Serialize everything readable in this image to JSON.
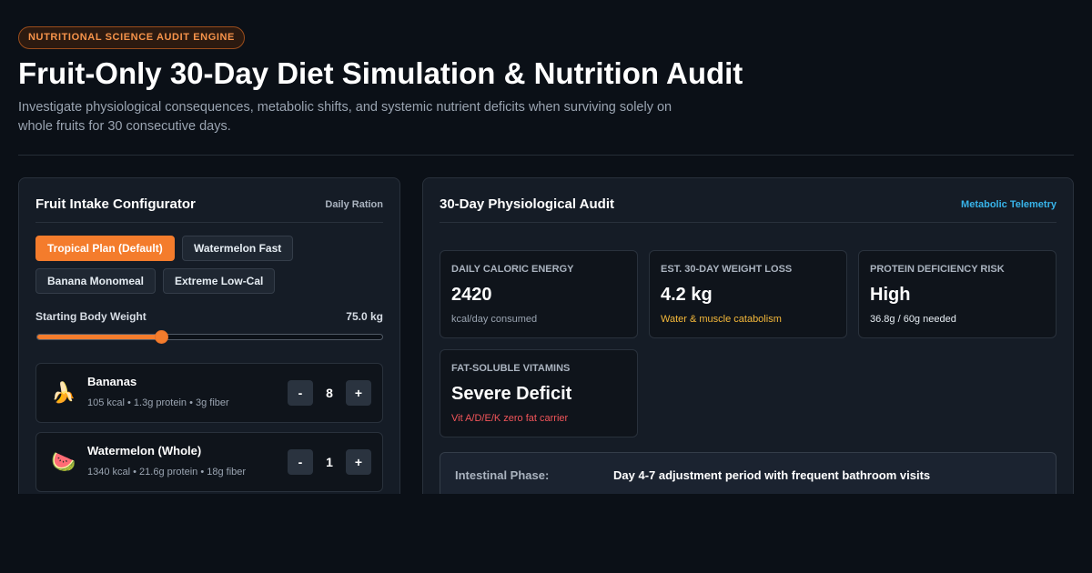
{
  "header": {
    "badge": "NUTRITIONAL SCIENCE AUDIT ENGINE",
    "title": "Fruit-Only 30-Day Diet Simulation & Nutrition Audit",
    "subtitle": "Investigate physiological consequences, metabolic shifts, and systemic nutrient deficits when surviving solely on whole fruits for 30 consecutive days."
  },
  "configurator": {
    "title": "Fruit Intake Configurator",
    "tag": "Daily Ration",
    "presets": [
      {
        "label": "Tropical Plan (Default)",
        "active": true
      },
      {
        "label": "Watermelon Fast",
        "active": false
      },
      {
        "label": "Banana Monomeal",
        "active": false
      },
      {
        "label": "Extreme Low-Cal",
        "active": false
      }
    ],
    "weight": {
      "label": "Starting Body Weight",
      "value_text": "75.0 kg",
      "level": 0.36
    },
    "fruits": [
      {
        "icon": "banana-icon",
        "emoji": "🍌",
        "name": "Bananas",
        "meta": "105 kcal • 1.3g protein • 3g fiber",
        "minus": "-",
        "count": "8",
        "plus": "+"
      },
      {
        "icon": "watermelon-icon",
        "emoji": "🍉",
        "name": "Watermelon (Whole)",
        "meta": "1340 kcal • 21.6g protein • 18g fiber",
        "minus": "-",
        "count": "1",
        "plus": "+"
      }
    ]
  },
  "audit": {
    "title": "30-Day Physiological Audit",
    "tag": "Metabolic Telemetry",
    "metrics": [
      {
        "label": "DAILY CALORIC ENERGY",
        "value": "2420",
        "note": "kcal/day consumed",
        "note_color": "#9aa4b1"
      },
      {
        "label": "EST. 30-DAY WEIGHT LOSS",
        "value": "4.2 kg",
        "note": "Water & muscle catabolism",
        "note_color": "#f5b93a"
      },
      {
        "label": "PROTEIN DEFICIENCY RISK",
        "value": "High",
        "note": "36.8g / 60g needed",
        "note_color": "#e6edf3"
      },
      {
        "label": "FAT-SOLUBLE VITAMINS",
        "value": "Severe Deficit",
        "note": "Vit A/D/E/K zero fat carrier",
        "note_color": "#f2555a"
      }
    ],
    "phase": {
      "label": "Intestinal Phase:",
      "text": "Day 4-7 adjustment period with frequent bathroom visits"
    }
  }
}
